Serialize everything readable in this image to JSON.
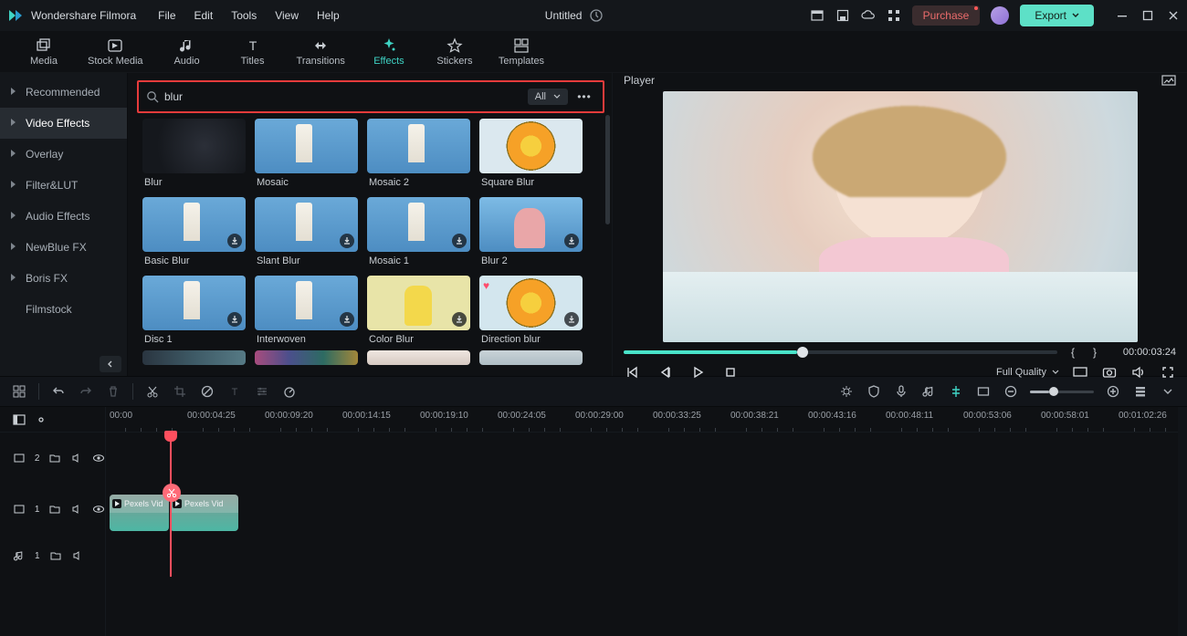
{
  "app_title": "Wondershare Filmora",
  "menu": [
    "File",
    "Edit",
    "Tools",
    "View",
    "Help"
  ],
  "doc_title": "Untitled",
  "purchase_label": "Purchase",
  "export_label": "Export",
  "top_tabs": [
    {
      "label": "Media"
    },
    {
      "label": "Stock Media"
    },
    {
      "label": "Audio"
    },
    {
      "label": "Titles"
    },
    {
      "label": "Transitions"
    },
    {
      "label": "Effects",
      "active": true
    },
    {
      "label": "Stickers"
    },
    {
      "label": "Templates"
    }
  ],
  "sidebar": [
    {
      "label": "Recommended",
      "caret": true
    },
    {
      "label": "Video Effects",
      "caret": true,
      "active": true
    },
    {
      "label": "Overlay",
      "caret": true
    },
    {
      "label": "Filter&LUT",
      "caret": true
    },
    {
      "label": "Audio Effects",
      "caret": true
    },
    {
      "label": "NewBlue FX",
      "caret": true
    },
    {
      "label": "Boris FX",
      "caret": true
    },
    {
      "label": "Filmstock",
      "caret": false
    }
  ],
  "search": {
    "value": "blur",
    "placeholder": "Search",
    "filter": "All"
  },
  "effects": [
    {
      "label": "Blur",
      "thumb": "th-dark"
    },
    {
      "label": "Mosaic",
      "thumb": "th-light"
    },
    {
      "label": "Mosaic 2",
      "thumb": "th-light"
    },
    {
      "label": "Square Blur",
      "thumb": "th-flower"
    },
    {
      "label": "Basic Blur",
      "thumb": "th-light",
      "dl": true
    },
    {
      "label": "Slant Blur",
      "thumb": "th-light",
      "dl": true
    },
    {
      "label": "Mosaic 1",
      "thumb": "th-light",
      "dl": true
    },
    {
      "label": "Blur 2",
      "thumb": "th-person",
      "dl": true
    },
    {
      "label": "Disc 1",
      "thumb": "th-light",
      "dl": true
    },
    {
      "label": "Interwoven",
      "thumb": "th-light",
      "dl": true
    },
    {
      "label": "Color Blur",
      "thumb": "th-yellow",
      "dl": true
    },
    {
      "label": "Direction blur",
      "thumb": "th-flower2",
      "dl": true,
      "heart": true
    }
  ],
  "player": {
    "title": "Player",
    "timestamp": "00:00:03:24",
    "quality": "Full Quality",
    "progress_pct": 40
  },
  "ruler_marks": [
    "00:00",
    "00:00:04:25",
    "00:00:09:20",
    "00:00:14:15",
    "00:00:19:10",
    "00:00:24:05",
    "00:00:29:00",
    "00:00:33:25",
    "00:00:38:21",
    "00:00:43:16",
    "00:00:48:11",
    "00:00:53:06",
    "00:00:58:01",
    "00:01:02:26"
  ],
  "tracks": {
    "video2": "2",
    "video1": "1",
    "audio1": "1"
  },
  "clip_label": "Pexels Vid"
}
